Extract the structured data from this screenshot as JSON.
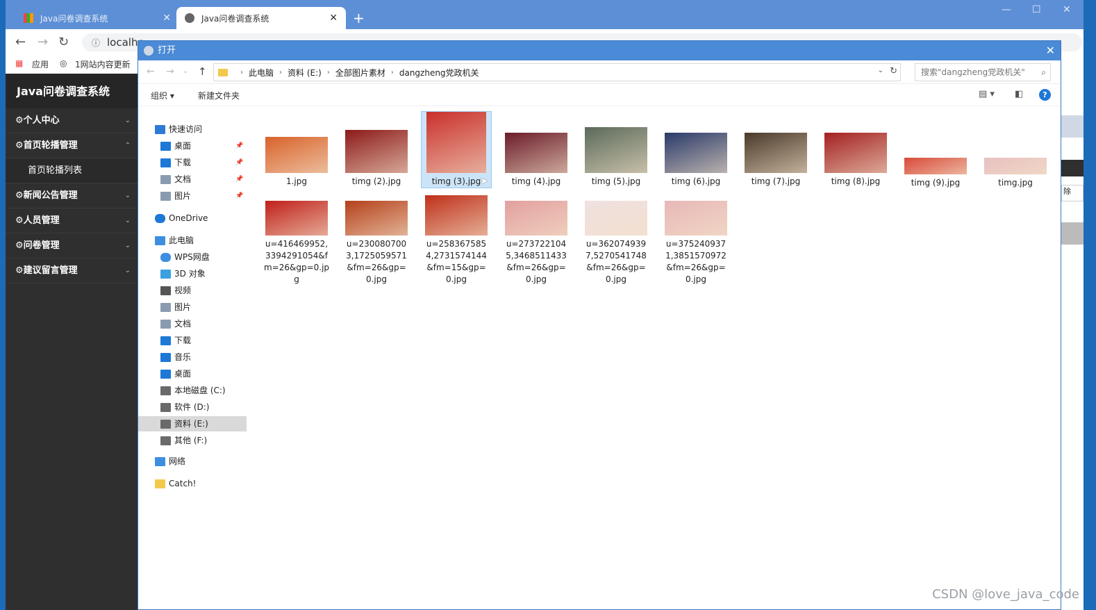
{
  "browser": {
    "tab_inactive": "Java问卷调查系统",
    "tab_active": "Java问卷调查系统",
    "new_tab": "+",
    "address": "localho",
    "bookmarks": [
      "应用",
      "1网站内容更新"
    ]
  },
  "app": {
    "title": "Java问卷调查系统",
    "menu": [
      {
        "label": "个人中心",
        "caret": "⌄"
      },
      {
        "label": "首页轮播管理",
        "caret": "⌃"
      },
      {
        "label": "新闻公告管理",
        "caret": "⌄"
      },
      {
        "label": "人员管理",
        "caret": "⌄"
      },
      {
        "label": "问卷管理",
        "caret": "⌄"
      },
      {
        "label": "建议留言管理",
        "caret": "⌄"
      }
    ],
    "submenu": [
      "首页轮播列表"
    ],
    "right_edge_text": "除"
  },
  "dialog": {
    "title": "打开",
    "breadcrumb": [
      "此电脑",
      "资料 (E:)",
      "全部图片素材",
      "dangzheng党政机关"
    ],
    "search_placeholder": "搜索\"dangzheng党政机关\"",
    "organize": "组织 ▾",
    "new_folder": "新建文件夹",
    "help": "?",
    "nav": [
      {
        "label": "快速访问",
        "icon": "star-icon",
        "color": "#2e7bd6"
      },
      {
        "label": "桌面",
        "icon": "desktop-icon",
        "color": "#1e78d6"
      },
      {
        "label": "下载",
        "icon": "download-icon",
        "color": "#1e78d6"
      },
      {
        "label": "文档",
        "icon": "document-icon",
        "color": "#8a9bb0"
      },
      {
        "label": "图片",
        "icon": "pictures-icon",
        "color": "#8a9bb0"
      },
      {
        "label": "OneDrive",
        "icon": "cloud-icon",
        "color": "#1e78d6"
      },
      {
        "label": "此电脑",
        "icon": "computer-icon",
        "color": "#3d8ee0"
      },
      {
        "label": "WPS网盘",
        "icon": "cloud-icon",
        "color": "#3d8ee0"
      },
      {
        "label": "3D 对象",
        "icon": "cube-icon",
        "color": "#3aa0e0"
      },
      {
        "label": "视频",
        "icon": "video-icon",
        "color": "#555555"
      },
      {
        "label": "图片",
        "icon": "pictures-icon",
        "color": "#8a9bb0"
      },
      {
        "label": "文档",
        "icon": "document-icon",
        "color": "#8a9bb0"
      },
      {
        "label": "下载",
        "icon": "download-icon",
        "color": "#1e78d6"
      },
      {
        "label": "音乐",
        "icon": "music-icon",
        "color": "#1e78d6"
      },
      {
        "label": "桌面",
        "icon": "desktop-icon",
        "color": "#1e78d6"
      },
      {
        "label": "本地磁盘 (C:)",
        "icon": "drive-icon",
        "color": "#6a6a6a"
      },
      {
        "label": "软件 (D:)",
        "icon": "drive-icon",
        "color": "#6a6a6a"
      },
      {
        "label": "资料 (E:)",
        "icon": "drive-icon",
        "color": "#6a6a6a"
      },
      {
        "label": "其他 (F:)",
        "icon": "drive-icon",
        "color": "#6a6a6a"
      },
      {
        "label": "网络",
        "icon": "network-icon",
        "color": "#3d8ee0"
      },
      {
        "label": "Catch!",
        "icon": "folder-icon",
        "color": "#f2c94c"
      }
    ],
    "files": [
      {
        "name": "1.jpg",
        "color": "#d9622b"
      },
      {
        "name": "timg (2).jpg",
        "color": "#8c1a1a"
      },
      {
        "name": "timg (3).jpg",
        "color": "#c9302c"
      },
      {
        "name": "timg (4).jpg",
        "color": "#6b1c2a"
      },
      {
        "name": "timg (5).jpg",
        "color": "#5a6a5a"
      },
      {
        "name": "timg (6).jpg",
        "color": "#2a3a6a"
      },
      {
        "name": "timg (7).jpg",
        "color": "#4a3a2a"
      },
      {
        "name": "timg (8).jpg",
        "color": "#a32020"
      },
      {
        "name": "timg (9).jpg",
        "color": "#d94a3a"
      },
      {
        "name": "timg.jpg",
        "color": "#e8c0c0"
      },
      {
        "name": "u=416469952,3394291054&fm=26&gp=0.jpg",
        "color": "#c0201a"
      },
      {
        "name": "u=2300807003,1725059571&fm=26&gp=0.jpg",
        "color": "#b5401a"
      },
      {
        "name": "u=2583675854,2731574144&fm=15&gp=0.jpg",
        "color": "#c0301a"
      },
      {
        "name": "u=2737221045,3468511433&fm=26&gp=0.jpg",
        "color": "#e3a0a0"
      },
      {
        "name": "u=3620749397,5270541748&fm=26&gp=0.jpg",
        "color": "#f0e0e0"
      },
      {
        "name": "u=3752409371,3851570972&fm=26&gp=0.jpg",
        "color": "#e8b8b8"
      }
    ]
  },
  "watermark": "CSDN @love_java_code"
}
